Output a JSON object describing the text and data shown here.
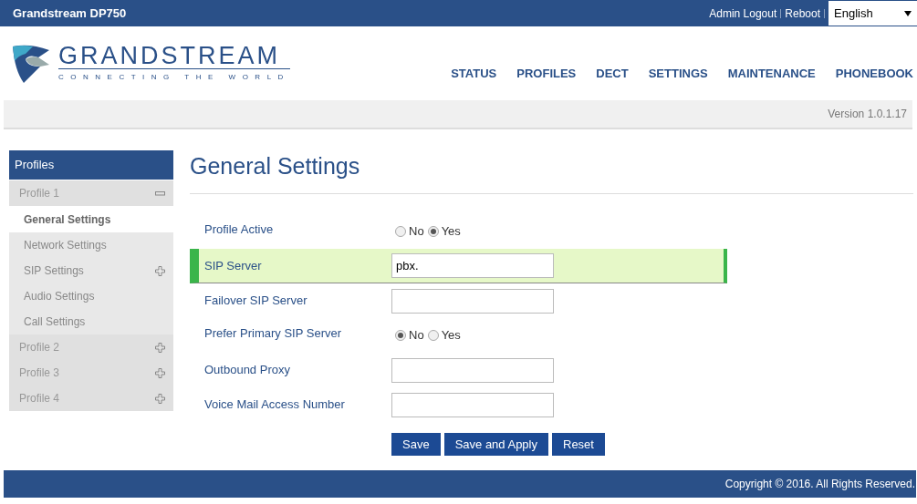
{
  "top_bar": {
    "title": "Grandstream DP750",
    "links": [
      "Admin Logout",
      "Reboot"
    ],
    "language": "English"
  },
  "logo": {
    "name": "GRANDSTREAM",
    "tagline": "CONNECTING THE WORLD"
  },
  "nav": [
    "STATUS",
    "PROFILES",
    "DECT",
    "SETTINGS",
    "MAINTENANCE",
    "PHONEBOOK"
  ],
  "version": "Version 1.0.1.17",
  "sidebar": {
    "title": "Profiles",
    "items": [
      {
        "label": "Profile 1",
        "expanded": true,
        "children": [
          {
            "label": "General Settings",
            "selected": true,
            "expandable": false
          },
          {
            "label": "Network Settings",
            "selected": false,
            "expandable": false
          },
          {
            "label": "SIP Settings",
            "selected": false,
            "expandable": true
          },
          {
            "label": "Audio Settings",
            "selected": false,
            "expandable": false
          },
          {
            "label": "Call Settings",
            "selected": false,
            "expandable": false
          }
        ]
      },
      {
        "label": "Profile 2",
        "expanded": false
      },
      {
        "label": "Profile 3",
        "expanded": false
      },
      {
        "label": "Profile 4",
        "expanded": false
      }
    ]
  },
  "page_title": "General Settings",
  "rows": [
    {
      "kind": "radio",
      "label": "Profile Active",
      "highlighted": false,
      "options": [
        {
          "label": "No",
          "selected": false
        },
        {
          "label": "Yes",
          "selected": true
        }
      ]
    },
    {
      "kind": "text",
      "label": "SIP Server",
      "highlighted": true,
      "value": "pbx."
    },
    {
      "kind": "text",
      "label": "Failover SIP Server",
      "highlighted": false
    },
    {
      "kind": "radio",
      "label": "Prefer Primary SIP Server",
      "highlighted": false,
      "options": [
        {
          "label": "No",
          "selected": true
        },
        {
          "label": "Yes",
          "selected": false
        }
      ]
    },
    {
      "kind": "text",
      "label": "Outbound Proxy",
      "highlighted": false
    },
    {
      "kind": "text",
      "label": "Voice Mail Access Number",
      "highlighted": false
    }
  ],
  "buttons": [
    "Save",
    "Save and Apply",
    "Reset"
  ],
  "footer": "Copyright © 2016. All Rights Reserved."
}
